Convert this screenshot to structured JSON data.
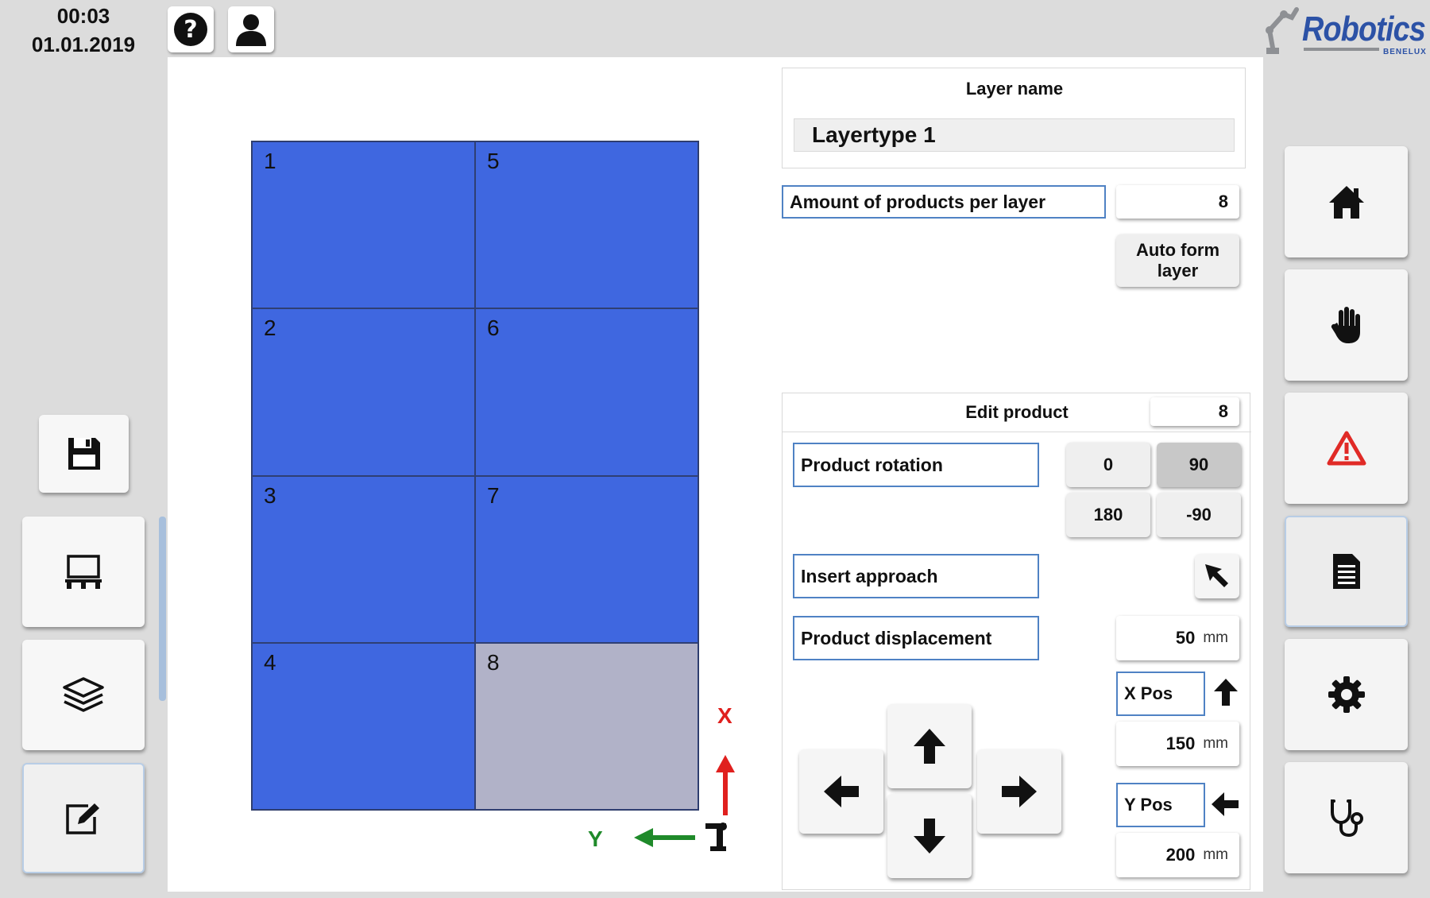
{
  "header": {
    "time": "00:03",
    "date": "01.01.2019",
    "logo_text": "Robotics",
    "logo_subtext": "BENELUX"
  },
  "layer": {
    "name_label": "Layer name",
    "name_value": "Layertype 1",
    "amount_label": "Amount of products per layer",
    "amount_value": "8",
    "auto_form_label": "Auto form layer"
  },
  "grid": {
    "cells": [
      "1",
      "2",
      "3",
      "4",
      "5",
      "6",
      "7",
      "8"
    ],
    "selected": "8"
  },
  "axes": {
    "x_label": "X",
    "y_label": "Y"
  },
  "edit": {
    "title": "Edit product",
    "product_value": "8",
    "rotation_label": "Product rotation",
    "rotation_options": [
      "0",
      "90",
      "180",
      "-90"
    ],
    "rotation_selected": "90",
    "insert_approach_label": "Insert approach",
    "displacement_label": "Product displacement",
    "displacement_value": "50",
    "unit": "mm",
    "x_pos_label": "X Pos",
    "x_pos_value": "150",
    "y_pos_label": "Y Pos",
    "y_pos_value": "200"
  },
  "colors": {
    "product_fill": "#3f67e0",
    "product_selected": "#b1b2c8",
    "field_border": "#4f82c4",
    "axis_x": "#e0201e",
    "axis_y": "#1f8a2a",
    "warning": "#e02a26",
    "brand": "#2c52a6"
  },
  "icons": {
    "left": [
      "save-icon",
      "pallet-icon",
      "layers-icon",
      "edit-icon"
    ],
    "top": [
      "help-icon",
      "user-icon"
    ],
    "right_nav": [
      "home-icon",
      "hand-icon",
      "warning-icon",
      "document-icon",
      "gear-icon",
      "stethoscope-icon"
    ]
  }
}
